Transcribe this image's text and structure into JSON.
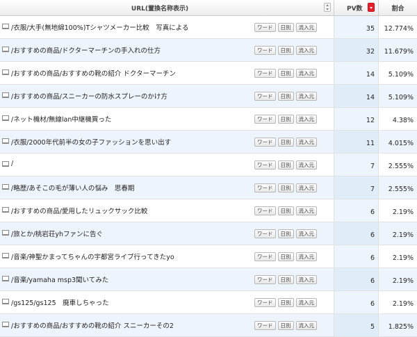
{
  "header": {
    "url_column": "URL(置換名称表示)",
    "pv_column": "PV数",
    "ratio_column": "割合"
  },
  "row_buttons": {
    "word": "ワード",
    "daily": "日別",
    "inflow": "流入元"
  },
  "rows": [
    {
      "url": "/衣服/大手(無地綿100%)Tシャツメーカー比較　写真による",
      "pv": "35",
      "ratio": "12.774%"
    },
    {
      "url": "/おすすめの商品/ドクターマーチンの手入れの仕方",
      "pv": "32",
      "ratio": "11.679%"
    },
    {
      "url": "/おすすめの商品/おすすめの靴の紹介 ドクターマーチン",
      "pv": "14",
      "ratio": "5.109%"
    },
    {
      "url": "/おすすめの商品/スニーカーの防水スプレーのかけ方",
      "pv": "14",
      "ratio": "5.109%"
    },
    {
      "url": "/ネット機材/無線lan中継機買った",
      "pv": "12",
      "ratio": "4.38%"
    },
    {
      "url": "/衣服/2000年代前半の女の子ファッションを思い出す",
      "pv": "11",
      "ratio": "4.015%"
    },
    {
      "url": "/",
      "pv": "7",
      "ratio": "2.555%"
    },
    {
      "url": "/略歴/あそこの毛が薄い人の悩み　思春期",
      "pv": "7",
      "ratio": "2.555%"
    },
    {
      "url": "/おすすめの商品/愛用したリュックサック比較",
      "pv": "6",
      "ratio": "2.19%"
    },
    {
      "url": "/旅とか/桃岩荘yhファンに告ぐ",
      "pv": "6",
      "ratio": "2.19%"
    },
    {
      "url": "/音楽/神聖かまってちゃんの宇都宮ライブ行ってきたyo",
      "pv": "6",
      "ratio": "2.19%"
    },
    {
      "url": "/音楽/yamaha msp3聞いてみた",
      "pv": "6",
      "ratio": "2.19%"
    },
    {
      "url": "/gs125/gs125　廃車しちゃった",
      "pv": "6",
      "ratio": "2.19%"
    },
    {
      "url": "/おすすめの商品/おすすめの靴の紹介 スニーカーその2",
      "pv": "5",
      "ratio": "1.825%"
    }
  ],
  "icons": {
    "row": "page-icon",
    "sort": "sort-arrows-icon",
    "sort_active": "sort-descending-icon"
  },
  "colors": {
    "alt_row": "#eef4fb",
    "sort_active": "#e8202c"
  }
}
